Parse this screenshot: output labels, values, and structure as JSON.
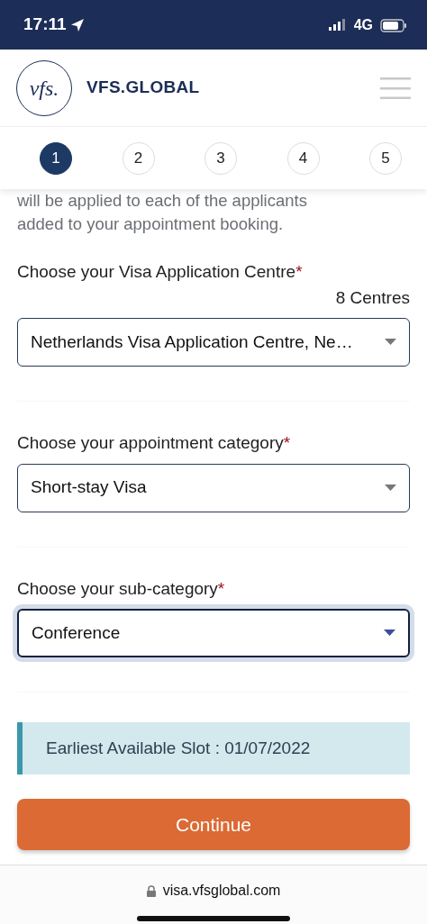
{
  "status_bar": {
    "time": "17:11",
    "network": "4G"
  },
  "header": {
    "brand": "VFS.GLOBAL",
    "logo_text": "vfs."
  },
  "steps": [
    {
      "label": "1",
      "selected": true
    },
    {
      "label": "2",
      "selected": false
    },
    {
      "label": "3",
      "selected": false
    },
    {
      "label": "4",
      "selected": false
    },
    {
      "label": "5",
      "selected": false
    }
  ],
  "intro": [
    "will be applied to each of the applicants",
    "added to your appointment booking."
  ],
  "fields": [
    {
      "label": "Choose your Visa Application Centre",
      "required_mark": "*",
      "count": "8 Centres",
      "value": "Netherlands Visa Application Centre, Ne…",
      "focused": false
    },
    {
      "label": "Choose your appointment category",
      "required_mark": "*",
      "value": "Short-stay Visa",
      "focused": false
    },
    {
      "label": "Choose your sub-category",
      "required_mark": "*",
      "value": "Conference",
      "focused": true
    }
  ],
  "alert": "Earliest Available Slot : 01/07/2022",
  "button": "Continue",
  "browser": {
    "url": "visa.vfsglobal.com"
  }
}
